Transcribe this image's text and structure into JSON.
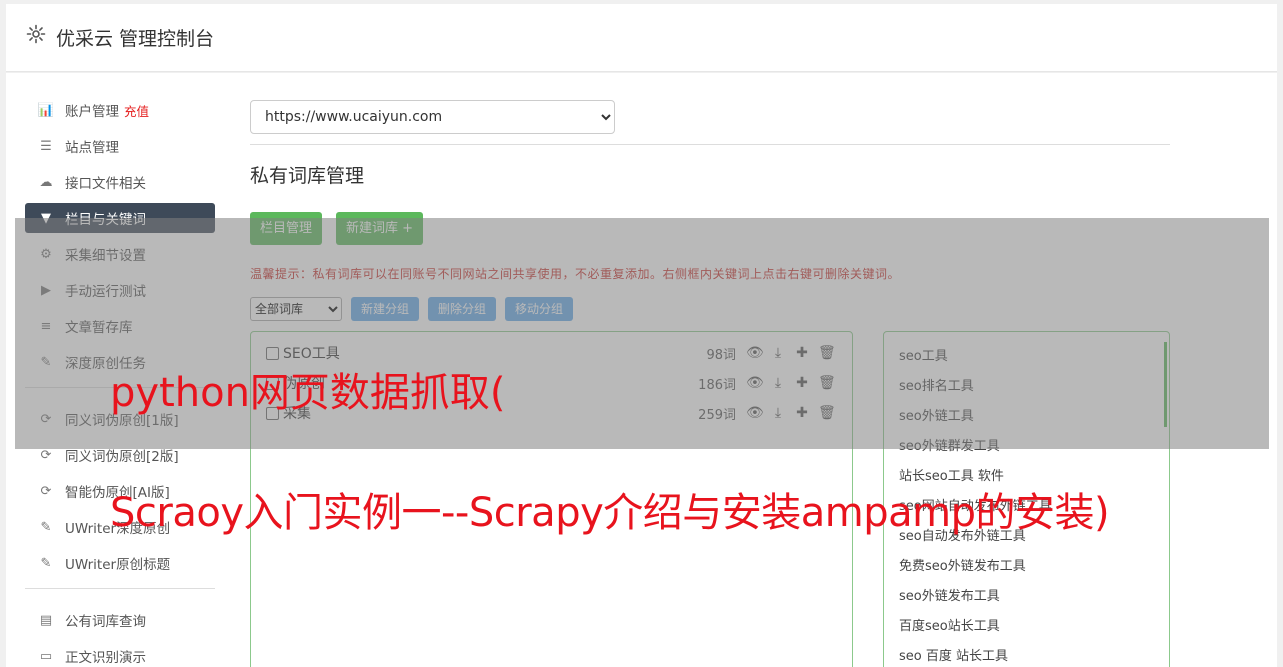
{
  "header": {
    "title": "优采云 管理控制台",
    "icon": "gear-icon"
  },
  "sidebar": {
    "items": [
      {
        "label": "账户管理",
        "badge": "充值",
        "icon": "bar-chart-icon"
      },
      {
        "label": "站点管理",
        "icon": "server-icon"
      },
      {
        "label": "接口文件相关",
        "icon": "cloud-upload-icon"
      },
      {
        "label": "栏目与关键词",
        "icon": "filter-icon",
        "active": true
      },
      {
        "label": "采集细节设置",
        "icon": "cogs-icon"
      },
      {
        "label": "手动运行测试",
        "icon": "play-circle-icon"
      },
      {
        "label": "文章暂存库",
        "icon": "database-icon"
      },
      {
        "label": "深度原创任务",
        "icon": "edit-icon"
      }
    ],
    "items2": [
      {
        "label": "同义词伪原创[1版]",
        "icon": "refresh-icon"
      },
      {
        "label": "同义词伪原创[2版]",
        "icon": "refresh-icon"
      },
      {
        "label": "智能伪原创[AI版]",
        "icon": "refresh-icon"
      },
      {
        "label": "UWriter深度原创",
        "icon": "edit-icon"
      },
      {
        "label": "UWriter原创标题",
        "icon": "edit-icon"
      }
    ],
    "items3": [
      {
        "label": "公有词库查询",
        "icon": "book-icon"
      },
      {
        "label": "正文识别演示",
        "icon": "monitor-icon"
      }
    ]
  },
  "main": {
    "site_select": "https://www.ucaiyun.com",
    "section_title": "私有词库管理",
    "btn_column": "栏目管理",
    "btn_new_lib": "新建词库 +",
    "tip": "温馨提示：私有词库可以在同账号不同网站之间共享使用，不必重复添加。右侧框内关键词上点击右键可删除关键词。",
    "group_select": "全部词库",
    "btn_new_group": "新建分组",
    "btn_del_group": "删除分组",
    "btn_move_group": "移动分组",
    "libraries": [
      {
        "name": "SEO工具",
        "count": "98词"
      },
      {
        "name": "伪原创",
        "count": "186词"
      },
      {
        "name": "采集",
        "count": "259词"
      }
    ],
    "keywords": [
      "seo工具",
      "seo排名工具",
      "seo外链工具",
      "seo外链群发工具",
      "站长seo工具 软件",
      "seo网站自动发布外链工具",
      "seo自动发布外链工具",
      "免费seo外链发布工具",
      "seo外链发布工具",
      "百度seo站长工具",
      "seo 百度 站长工具"
    ]
  },
  "watermark": {
    "line1": "python网页数据抓取(",
    "line2": "Scraoy入门实例一--Scrapy介绍与安装ampamp的安装)"
  },
  "colors": {
    "accent_green": "#5cb85c",
    "active_nav": "#3e4a59",
    "watermark": "#e8131d",
    "tip": "#c9302c"
  }
}
